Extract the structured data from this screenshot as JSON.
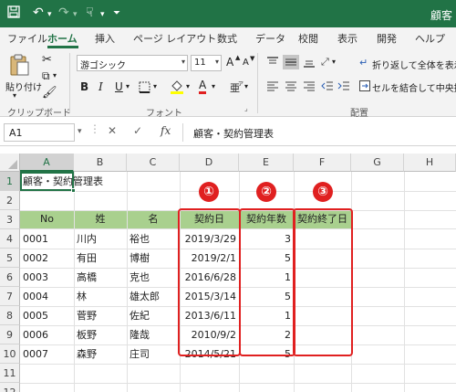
{
  "titlebar": {
    "title": "顧客",
    "bg": "#217346",
    "icons": [
      "save-icon",
      "undo-icon",
      "redo-icon",
      "touch-mode-icon",
      "customize-qat-icon"
    ]
  },
  "tabs": [
    {
      "label": "ファイル",
      "active": false
    },
    {
      "label": "ホーム",
      "active": true
    },
    {
      "label": "挿入",
      "active": false
    },
    {
      "label": "ページ レイアウト",
      "active": false
    },
    {
      "label": "数式",
      "active": false
    },
    {
      "label": "データ",
      "active": false
    },
    {
      "label": "校閲",
      "active": false
    },
    {
      "label": "表示",
      "active": false
    },
    {
      "label": "開発",
      "active": false
    },
    {
      "label": "ヘルプ",
      "active": false
    }
  ],
  "ribbon": {
    "paste_label": "貼り付け",
    "clipboard_group": "クリップボード",
    "font_name": "游ゴシック",
    "font_size": "11",
    "grow_font": "A",
    "shrink_font": "A",
    "bold": "B",
    "italic": "I",
    "underline": "U",
    "font_color_glyph": "A",
    "font_group": "フォント",
    "wrap_text": "折り返して全体を表示す",
    "merge_center": "セルを結合して中央揃え",
    "alignment_group": "配置"
  },
  "formula_bar": {
    "name_box": "A1",
    "cancel": "✕",
    "enter": "✓",
    "fx": "fx",
    "content": "顧客・契約管理表"
  },
  "grid": {
    "columns": [
      "A",
      "B",
      "C",
      "D",
      "E",
      "F",
      "G",
      "H"
    ],
    "rows": [
      "1",
      "2",
      "3",
      "4",
      "5",
      "6",
      "7",
      "8",
      "9",
      "10",
      "11",
      "12"
    ],
    "title_cell": "顧客・契約管理表",
    "headers": [
      "No",
      "姓",
      "名",
      "契約日",
      "契約年数",
      "契約終了日"
    ],
    "data": [
      [
        "0001",
        "川内",
        "裕也",
        "2019/3/29",
        "3",
        ""
      ],
      [
        "0002",
        "有田",
        "博樹",
        "2019/2/1",
        "5",
        ""
      ],
      [
        "0003",
        "高橋",
        "克也",
        "2016/6/28",
        "1",
        ""
      ],
      [
        "0004",
        "林",
        "雄太郎",
        "2015/3/14",
        "5",
        ""
      ],
      [
        "0005",
        "菅野",
        "佐紀",
        "2013/6/11",
        "1",
        ""
      ],
      [
        "0006",
        "板野",
        "隆哉",
        "2010/9/2",
        "2",
        ""
      ],
      [
        "0007",
        "森野",
        "庄司",
        "2014/5/21",
        "5",
        ""
      ]
    ],
    "header_fill": "#a9d08e"
  },
  "annotations": {
    "markers": [
      "①",
      "②",
      "③"
    ],
    "color": "#e02020"
  }
}
